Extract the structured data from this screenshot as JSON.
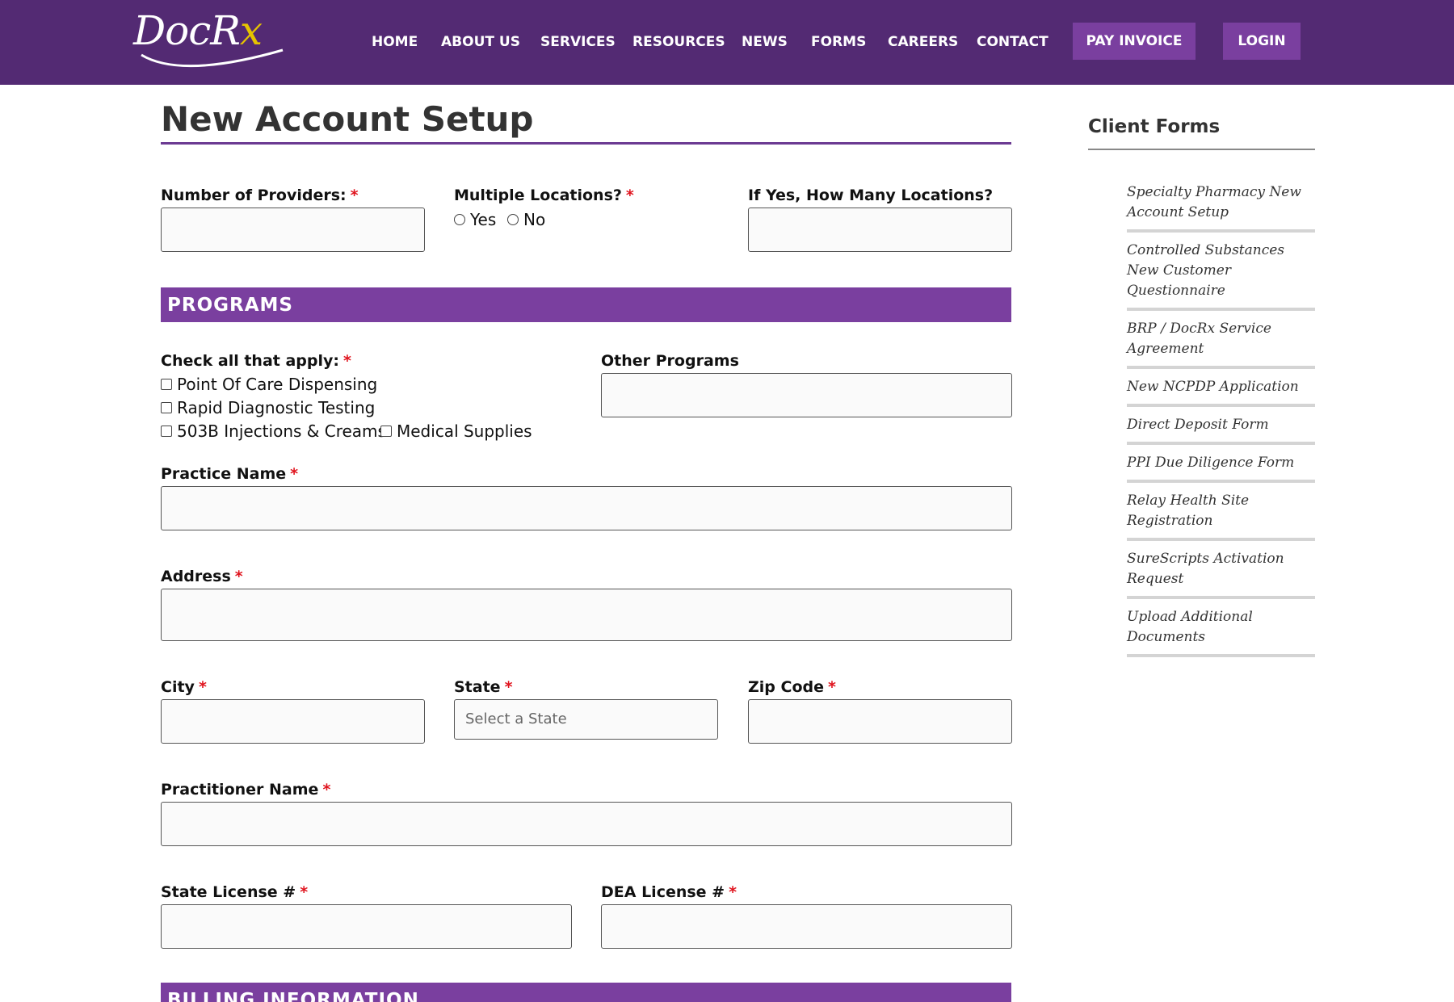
{
  "header": {
    "logo_text": "DocR",
    "logo_text_x": "x",
    "nav": [
      "HOME",
      "ABOUT US",
      "SERVICES",
      "RESOURCES",
      "NEWS",
      "FORMS",
      "CAREERS",
      "CONTACT"
    ],
    "pay_invoice": "PAY INVOICE",
    "login": "LOGIN"
  },
  "main": {
    "title": "New Account Setup",
    "providers_label": "Number of Providers:",
    "multiple_label": "Multiple Locations?",
    "yes": "Yes",
    "no": "No",
    "how_many_label": "If Yes, How Many Locations?",
    "programs_heading": "PROGRAMS",
    "check_all_label": "Check all that apply:",
    "programs": [
      "Point Of Care Dispensing",
      "Rapid Diagnostic Testing",
      "503B Injections & Creams",
      "Medical Supplies"
    ],
    "other_programs_label": "Other Programs",
    "practice_name_label": "Practice Name",
    "address_label": "Address",
    "city_label": "City",
    "state_label": "State",
    "state_placeholder": "Select a State",
    "zip_label": "Zip Code",
    "practitioner_label": "Practitioner Name",
    "state_license_label": "State License #",
    "dea_license_label": "DEA License #",
    "billing_heading": "BILLING INFORMATION",
    "required_mark": "*"
  },
  "sidebar": {
    "title": "Client Forms",
    "items": [
      "Specialty Pharmacy New Account Setup",
      "Controlled Substances New Customer Questionnaire",
      "BRP / DocRx Service Agreement",
      "New NCPDP Application",
      "Direct Deposit Form",
      "PPI Due Diligence Form",
      "Relay Health Site Registration",
      "SureScripts Activation Request",
      "Upload Additional Documents"
    ]
  },
  "colors": {
    "header_bg": "#532a73",
    "accent": "#7a3f9f",
    "logo_accent": "#e6c400",
    "required": "#e0141e"
  },
  "icons": [
    "radio-icon",
    "checkbox-icon"
  ]
}
